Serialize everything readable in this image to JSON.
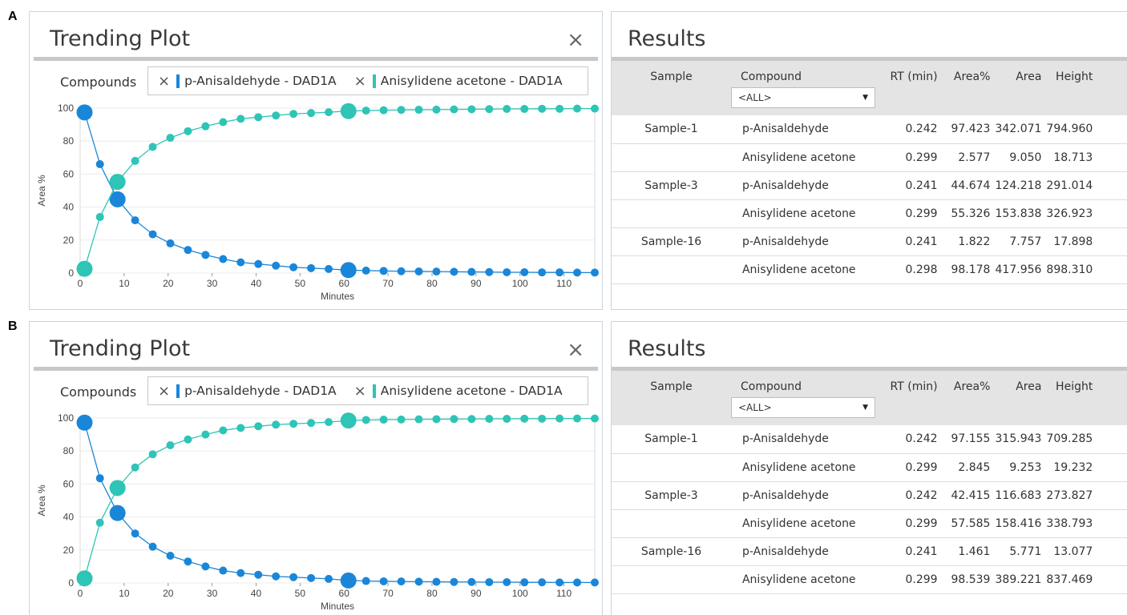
{
  "panels": [
    {
      "label": "A",
      "trending": {
        "title": "Trending Plot",
        "compounds_label": "Compounds",
        "chips": [
          {
            "name": "p-Anisaldehyde - DAD1A",
            "color": "#1a86d8"
          },
          {
            "name": "Anisylidene acetone - DAD1A",
            "color": "#2ec4b6"
          }
        ]
      },
      "chart_data": {
        "type": "scatter",
        "xlabel": "Minutes",
        "ylabel": "Area %",
        "xlim": [
          0,
          117
        ],
        "ylim": [
          0,
          100
        ],
        "xticks": [
          0,
          10,
          20,
          30,
          40,
          50,
          60,
          70,
          80,
          90,
          100,
          110
        ],
        "yticks": [
          0,
          20,
          40,
          60,
          80,
          100
        ],
        "x": [
          1,
          4.5,
          8.5,
          12.5,
          16.5,
          20.5,
          24.5,
          28.5,
          32.5,
          36.5,
          40.5,
          44.5,
          48.5,
          52.5,
          56.5,
          61,
          65,
          69,
          73,
          77,
          81,
          85,
          89,
          93,
          97,
          101,
          105,
          109,
          113,
          117
        ],
        "series": [
          {
            "name": "p-Anisaldehyde - DAD1A",
            "color": "#1a86d8",
            "values": [
              97.4,
              66,
              44.7,
              32,
              23.5,
              18,
              14,
              11,
              8.5,
              6.5,
              5.5,
              4.5,
              3.5,
              3,
              2.5,
              1.8,
              1.5,
              1.3,
              1.1,
              1,
              0.9,
              0.8,
              0.7,
              0.6,
              0.5,
              0.5,
              0.4,
              0.4,
              0.3,
              0.3
            ]
          },
          {
            "name": "Anisylidene acetone - DAD1A",
            "color": "#2ec4b6",
            "values": [
              2.6,
              34,
              55.3,
              68,
              76.5,
              82,
              86,
              89,
              91.5,
              93.5,
              94.5,
              95.5,
              96.5,
              97,
              97.5,
              98.2,
              98.5,
              98.7,
              98.9,
              99,
              99.1,
              99.2,
              99.3,
              99.4,
              99.5,
              99.5,
              99.6,
              99.6,
              99.7,
              99.7
            ]
          }
        ],
        "highlighted_x": [
          1,
          8.5,
          61
        ]
      },
      "results": {
        "title": "Results",
        "headers": {
          "sample": "Sample",
          "compound": "Compound",
          "rt": "RT (min)",
          "area_pct": "Area%",
          "area": "Area",
          "height": "Height"
        },
        "filter": "<ALL>",
        "rows": [
          {
            "sample": "Sample-1",
            "compound": "p-Anisaldehyde",
            "rt": "0.242",
            "area_pct": "97.423",
            "area": "342.071",
            "height": "794.960"
          },
          {
            "sample": "",
            "compound": "Anisylidene acetone",
            "rt": "0.299",
            "area_pct": "2.577",
            "area": "9.050",
            "height": "18.713"
          },
          {
            "sample": "Sample-3",
            "compound": "p-Anisaldehyde",
            "rt": "0.241",
            "area_pct": "44.674",
            "area": "124.218",
            "height": "291.014"
          },
          {
            "sample": "",
            "compound": "Anisylidene acetone",
            "rt": "0.299",
            "area_pct": "55.326",
            "area": "153.838",
            "height": "326.923"
          },
          {
            "sample": "Sample-16",
            "compound": "p-Anisaldehyde",
            "rt": "0.241",
            "area_pct": "1.822",
            "area": "7.757",
            "height": "17.898"
          },
          {
            "sample": "",
            "compound": "Anisylidene acetone",
            "rt": "0.298",
            "area_pct": "98.178",
            "area": "417.956",
            "height": "898.310"
          }
        ]
      }
    },
    {
      "label": "B",
      "trending": {
        "title": "Trending Plot",
        "compounds_label": "Compounds",
        "chips": [
          {
            "name": "p-Anisaldehyde - DAD1A",
            "color": "#1a86d8"
          },
          {
            "name": "Anisylidene acetone - DAD1A",
            "color": "#2ec4b6"
          }
        ]
      },
      "chart_data": {
        "type": "scatter",
        "xlabel": "Minutes",
        "ylabel": "Area %",
        "xlim": [
          0,
          117
        ],
        "ylim": [
          0,
          100
        ],
        "xticks": [
          0,
          10,
          20,
          30,
          40,
          50,
          60,
          70,
          80,
          90,
          100,
          110
        ],
        "yticks": [
          0,
          20,
          40,
          60,
          80,
          100
        ],
        "x": [
          1,
          4.5,
          8.5,
          12.5,
          16.5,
          20.5,
          24.5,
          28.5,
          32.5,
          36.5,
          40.5,
          44.5,
          48.5,
          52.5,
          56.5,
          61,
          65,
          69,
          73,
          77,
          81,
          85,
          89,
          93,
          97,
          101,
          105,
          109,
          113,
          117
        ],
        "series": [
          {
            "name": "p-Anisaldehyde - DAD1A",
            "color": "#1a86d8",
            "values": [
              97.2,
              63.5,
              42.4,
              30,
              22,
              16.5,
              13,
              10,
              7.5,
              6,
              5,
              4,
              3.5,
              3,
              2.5,
              1.5,
              1.2,
              1,
              0.9,
              0.8,
              0.7,
              0.6,
              0.6,
              0.5,
              0.5,
              0.4,
              0.4,
              0.3,
              0.3,
              0.3
            ]
          },
          {
            "name": "Anisylidene acetone - DAD1A",
            "color": "#2ec4b6",
            "values": [
              2.8,
              36.5,
              57.6,
              70,
              78,
              83.5,
              87,
              90,
              92.5,
              94,
              95,
              96,
              96.5,
              97,
              97.5,
              98.5,
              98.8,
              99,
              99.1,
              99.2,
              99.3,
              99.4,
              99.4,
              99.5,
              99.5,
              99.6,
              99.6,
              99.7,
              99.7,
              99.7
            ]
          }
        ],
        "highlighted_x": [
          1,
          8.5,
          61
        ]
      },
      "results": {
        "title": "Results",
        "headers": {
          "sample": "Sample",
          "compound": "Compound",
          "rt": "RT (min)",
          "area_pct": "Area%",
          "area": "Area",
          "height": "Height"
        },
        "filter": "<ALL>",
        "rows": [
          {
            "sample": "Sample-1",
            "compound": "p-Anisaldehyde",
            "rt": "0.242",
            "area_pct": "97.155",
            "area": "315.943",
            "height": "709.285"
          },
          {
            "sample": "",
            "compound": "Anisylidene acetone",
            "rt": "0.299",
            "area_pct": "2.845",
            "area": "9.253",
            "height": "19.232"
          },
          {
            "sample": "Sample-3",
            "compound": "p-Anisaldehyde",
            "rt": "0.242",
            "area_pct": "42.415",
            "area": "116.683",
            "height": "273.827"
          },
          {
            "sample": "",
            "compound": "Anisylidene acetone",
            "rt": "0.299",
            "area_pct": "57.585",
            "area": "158.416",
            "height": "338.793"
          },
          {
            "sample": "Sample-16",
            "compound": "p-Anisaldehyde",
            "rt": "0.241",
            "area_pct": "1.461",
            "area": "5.771",
            "height": "13.077"
          },
          {
            "sample": "",
            "compound": "Anisylidene acetone",
            "rt": "0.299",
            "area_pct": "98.539",
            "area": "389.221",
            "height": "837.469"
          }
        ]
      }
    }
  ]
}
